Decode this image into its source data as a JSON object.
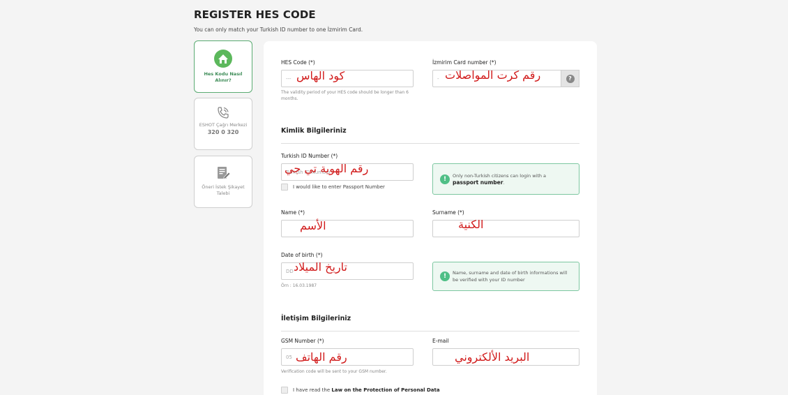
{
  "header": {
    "title": "REGISTER HES CODE",
    "subtitle": "You can only match your Turkish ID number to one İzmirim Card."
  },
  "sidebar": {
    "items": [
      {
        "label": "Hes Kodu Nasıl Alınır?",
        "icon": "house-icon",
        "active": true
      },
      {
        "label": "ESHOT Çağrı Merkezi",
        "number": "320 0 320",
        "icon": "phone-icon"
      },
      {
        "label": "Öneri İstek Şikayet Talebi",
        "icon": "document-edit-icon"
      }
    ]
  },
  "form": {
    "hes_code": {
      "label": "HES Code (*)",
      "value": "---",
      "annotation": "كود الهاس",
      "hint": "The validity period of your HES code should be longer than 6 months."
    },
    "card_number": {
      "label": "İzmirim Card number (*)",
      "value": "-",
      "annotation": "رقم كرت المواصلات",
      "help": "?"
    },
    "identity_section": {
      "title": "Kimlik Bilgileriniz"
    },
    "tc_number": {
      "label": "Turkish ID Number (*)",
      "placeholder": "Turkish ID Number",
      "annotation": "رقم الهوية تي جي"
    },
    "passport_checkbox": {
      "label": "I would like to enter Passport Number"
    },
    "passport_info": {
      "text": "Only non-Turkish citizens can login with a",
      "bold": "passport number",
      "suffix": "."
    },
    "name": {
      "label": "Name (*)",
      "annotation": "الأسم"
    },
    "surname": {
      "label": "Surname (*)",
      "annotation": "الكنية"
    },
    "dob": {
      "label": "Date of birth (*)",
      "placeholder": "DD",
      "annotation": "تاريخ الميلاد",
      "hint": "Örn : 16.03.1987"
    },
    "verify_info": {
      "text": "Name, surname and date of birth informations will be verified with your ID number"
    },
    "contact_section": {
      "title": "İletişim Bilgileriniz"
    },
    "gsm": {
      "label": "GSM Number (*)",
      "value": "05",
      "annotation": "رقم الهاتف",
      "hint": "Verification code will be sent to your GSM number."
    },
    "email": {
      "label": "E-mail",
      "annotation": "البريد الألكتروني"
    },
    "kvkk_checkbox": {
      "prefix": "I have read the",
      "bold": "Law on the Protection of Personal Data"
    }
  },
  "colors": {
    "accent_green": "#4fbf86",
    "annotation_red": "#d11a1a"
  }
}
